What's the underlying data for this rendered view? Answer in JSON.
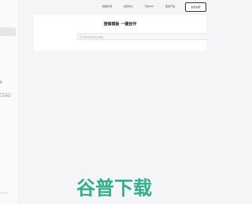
{
  "sidebar": {
    "digit": "0",
    "chips": [
      "",
      "Beta"
    ],
    "footer": "京ICP备"
  },
  "topnav": {
    "links": [
      "模板标准",
      "会员中心",
      "下载APP",
      "更多产品"
    ],
    "upload_label": "会员充值"
  },
  "search": {
    "title": "搜索模板 一键创作",
    "placeholder": "搜索你想要的设计模板",
    "icon": "search-icon"
  },
  "watermark": {
    "text": "谷普下载",
    "color": "#2db08c"
  }
}
